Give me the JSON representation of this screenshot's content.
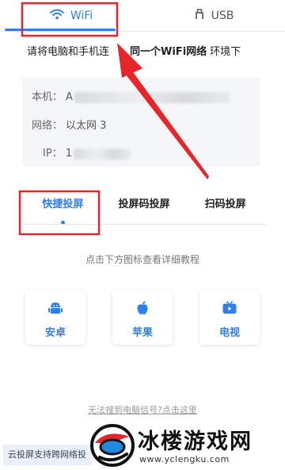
{
  "connection_tabs": [
    {
      "label": "WiFi",
      "icon": "wifi-icon",
      "active": true
    },
    {
      "label": "USB",
      "icon": "usb-icon",
      "active": false
    }
  ],
  "instruction": {
    "prefix": "请将电脑和手机连",
    "bold": "同一个WiFi网络",
    "suffix": "环境下"
  },
  "info": {
    "local_label": "本机：",
    "local_value": "A",
    "network_label": "网络：",
    "network_value": "以太网 3",
    "ip_label": "IP：",
    "ip_value": "1"
  },
  "mode_tabs": [
    {
      "label": "快捷投屏",
      "active": true
    },
    {
      "label": "投屏码投屏",
      "active": false
    },
    {
      "label": "扫码投屏",
      "active": false
    }
  ],
  "hint": "点击下方图标查看详细教程",
  "platforms": [
    {
      "label": "安卓",
      "icon": "android-icon"
    },
    {
      "label": "苹果",
      "icon": "apple-icon"
    },
    {
      "label": "电视",
      "icon": "tv-icon"
    }
  ],
  "help_link": "无法搜到电脑信号?点击这里",
  "footer_note": "云投屏支持跨网络投",
  "watermark": {
    "title": "冰楼游戏网",
    "url": "www.yclengku.com"
  },
  "colors": {
    "accent": "#2f7ff0",
    "annotation": "#e8262a"
  }
}
